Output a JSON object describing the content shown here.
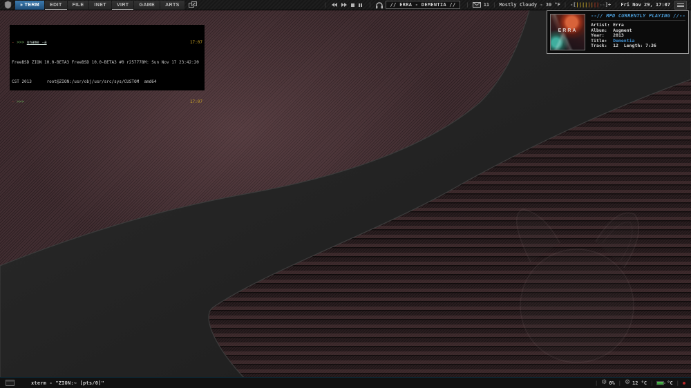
{
  "colors": {
    "accent_blue": "#2f6f9f",
    "wallpaper_maroon": "#422e32",
    "swoosh_dark": "#232323",
    "mpd_title_blue": "#4a9ad4",
    "terminal_time_yellow": "#c9a227",
    "battery_green": "#58c858"
  },
  "topbar": {
    "tabs": [
      {
        "label": "» TERM"
      },
      {
        "label": "EDIT"
      },
      {
        "label": "FILE"
      },
      {
        "label": "INET"
      },
      {
        "label": "VIRT"
      },
      {
        "label": "GAME"
      },
      {
        "label": "ARTS"
      }
    ],
    "now_playing": "// ERRA - DEMENTIA //",
    "mail_count": "11",
    "weather": "Mostly Cloudy - 30 °F",
    "volume": {
      "prefix": "-[",
      "bars_yellow": "||||",
      "bars_orange": "||",
      "bars_red": "||",
      "bars_off": "--",
      "suffix": "]+"
    },
    "clock": "Fri Nov 29, 17:07"
  },
  "mpd": {
    "header": "--// MPD CURRENTLY PLAYING //--",
    "album_art_text": "ERRA",
    "artist_label": "Artist:",
    "artist": "Erra",
    "album_label": "Album:",
    "album": "Augment",
    "year_label": "Year:",
    "year": "2013",
    "title_label": "Title:",
    "title": "Dementia",
    "track_label": "Track:",
    "track": "12",
    "length_label": "Length:",
    "length": "7:36"
  },
  "terminal": {
    "prompt_dash": "-",
    "prompt_arrows": ">>>",
    "command": "uname -a",
    "time1": "17:07",
    "output1": "FreeBSD ZION 10.0-BETA3 FreeBSD 10.0-BETA3 #0 r257778M: Sun Nov 17 23:42:20",
    "output2": "CST 2013      root@ZION:/usr/obj/usr/src/sys/CUSTOM  amd64",
    "time2": "17:07"
  },
  "bottombar": {
    "window_title": "xterm - \"ZION:~  [pts/0]\"",
    "cpu": "0%",
    "temp": "12 °C",
    "battery_temp": "°C"
  }
}
